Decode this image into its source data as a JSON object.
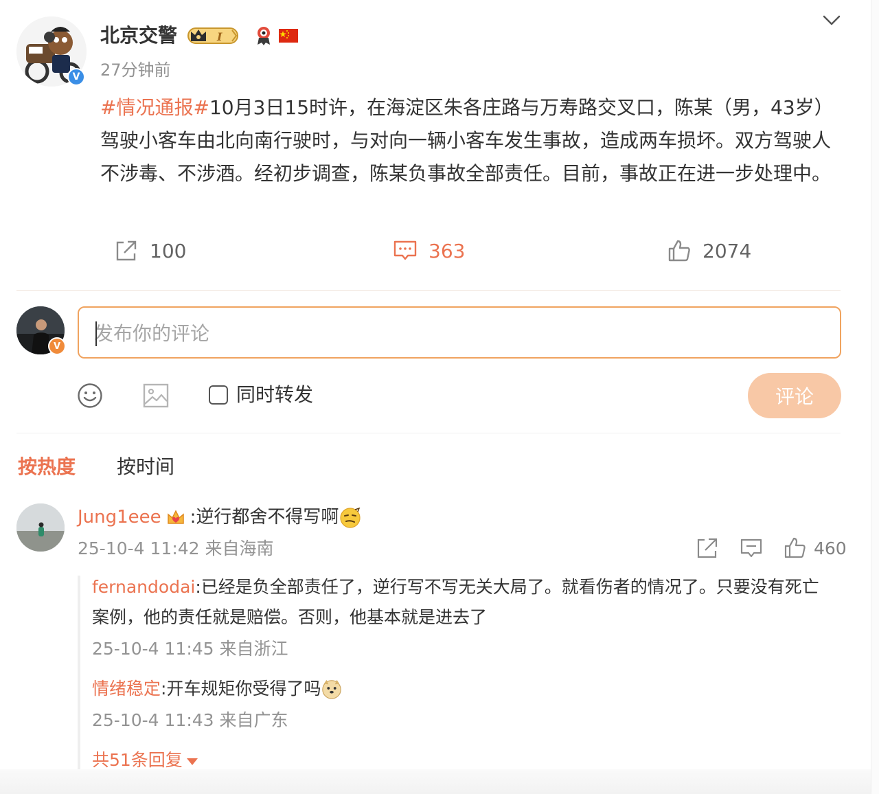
{
  "post": {
    "author": "北京交警",
    "time": "27分钟前",
    "vip_level": "I",
    "hashtag": "#情况通报#",
    "body": "10月3日15时许，在海淀区朱各庄路与万寿路交叉口，陈某（男，43岁）驾驶小客车由北向南行驶时，与对向一辆小客车发生事故，造成两车损坏。双方驾驶人不涉毒、不涉酒。经初步调查，陈某负事故全部责任。目前，事故正在进一步处理中。",
    "reposts": "100",
    "comments": "363",
    "likes": "2074",
    "verified_mark": "V"
  },
  "composer": {
    "placeholder": "发布你的评论",
    "also_repost": "同时转发",
    "submit": "评论",
    "badge": "V"
  },
  "tabs": {
    "hot": "按热度",
    "time": "按时间"
  },
  "comment": {
    "user": "Jung1eee",
    "text": ":逆行都舍不得写啊",
    "meta": "25-10-4 11:42 来自海南",
    "likes": "460",
    "replies": [
      {
        "user": "fernandodai",
        "text": ":已经是负全部责任了，逆行写不写无关大局了。就看伤者的情况了。只要没有死亡案例，他的责任就是赔偿。否则，他基本就是进去了",
        "meta": "25-10-4 11:45 来自浙江"
      },
      {
        "user": "情绪稳定",
        "text": ":开车规矩你受得了吗",
        "meta": "25-10-4 11:43 来自广东"
      }
    ],
    "more": "共51条回复"
  },
  "colors": {
    "accent": "#eb7350",
    "muted": "#939393",
    "button_disabled": "#f8c8a6"
  },
  "icons": [
    "chevron-down-icon",
    "repost-icon",
    "comment-icon",
    "like-icon",
    "emoji-icon",
    "image-icon",
    "vip-crown-icon",
    "medal-icon",
    "china-flag-icon"
  ]
}
